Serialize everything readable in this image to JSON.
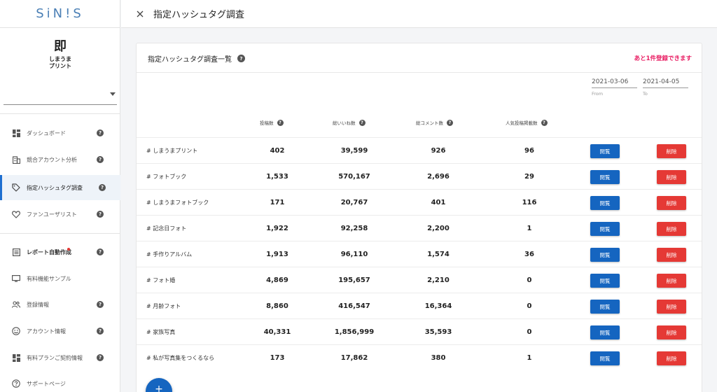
{
  "app": {
    "logo": "SiN!S"
  },
  "account": {
    "mark": "即",
    "name": "しまうま\nプリント",
    "select_value": ""
  },
  "sidebar": {
    "items": [
      {
        "label": "ダッシュボード",
        "icon": "dashboard-icon",
        "help": "?"
      },
      {
        "label": "競合アカウント分析",
        "icon": "building-icon",
        "help": "?"
      },
      {
        "label": "指定ハッシュタグ調査",
        "icon": "tag-icon",
        "help": "?"
      },
      {
        "label": "ファンユーザリスト",
        "icon": "heart-icon",
        "help": "?"
      },
      {
        "label": "レポート自動作成",
        "icon": "report-icon",
        "help": "?"
      },
      {
        "label": "有料機能サンプル",
        "icon": "monitor-icon",
        "help": ""
      },
      {
        "label": "登録情報",
        "icon": "people-icon",
        "help": "?"
      },
      {
        "label": "アカウント情報",
        "icon": "smile-icon",
        "help": "?"
      },
      {
        "label": "有料プランご契約情報",
        "icon": "dashboard-icon",
        "help": "?"
      },
      {
        "label": "サポートページ",
        "icon": "question-circle-icon",
        "help": ""
      }
    ]
  },
  "header": {
    "close": "×",
    "title": "指定ハッシュタグ調査"
  },
  "card": {
    "title": "指定ハッシュタグ調査一覧",
    "remaining": "あと1件登録できます",
    "date_from": {
      "value": "2021-03-06",
      "label": "From"
    },
    "date_to": {
      "value": "2021-04-05",
      "label": "To"
    },
    "columns": [
      "投稿数",
      "総いいね数",
      "総コメント数",
      "人気投稿掲載数"
    ],
    "view_label": "閲覧",
    "delete_label": "削除",
    "rows": [
      {
        "tag": "# しまうまプリント",
        "posts": "402",
        "likes": "39,599",
        "comments": "926",
        "popular": "96"
      },
      {
        "tag": "# フォトブック",
        "posts": "1,533",
        "likes": "570,167",
        "comments": "2,696",
        "popular": "29"
      },
      {
        "tag": "# しまうまフォトブック",
        "posts": "171",
        "likes": "20,767",
        "comments": "401",
        "popular": "116"
      },
      {
        "tag": "# 記念日フォト",
        "posts": "1,922",
        "likes": "92,258",
        "comments": "2,200",
        "popular": "1"
      },
      {
        "tag": "# 手作りアルバム",
        "posts": "1,913",
        "likes": "96,110",
        "comments": "1,574",
        "popular": "36"
      },
      {
        "tag": "# フォト婚",
        "posts": "4,869",
        "likes": "195,657",
        "comments": "2,210",
        "popular": "0"
      },
      {
        "tag": "# 月齢フォト",
        "posts": "8,860",
        "likes": "416,547",
        "comments": "16,364",
        "popular": "0"
      },
      {
        "tag": "# 家族写真",
        "posts": "40,331",
        "likes": "1,856,999",
        "comments": "35,593",
        "popular": "0"
      },
      {
        "tag": "# 私が写真集をつくるなら",
        "posts": "173",
        "likes": "17,862",
        "comments": "380",
        "popular": "1"
      }
    ]
  },
  "fab": {
    "label": "+"
  },
  "colors": {
    "primary": "#1565c0",
    "danger": "#e53935",
    "accent_pink": "#e91e63",
    "logo": "#4a7fb5"
  }
}
